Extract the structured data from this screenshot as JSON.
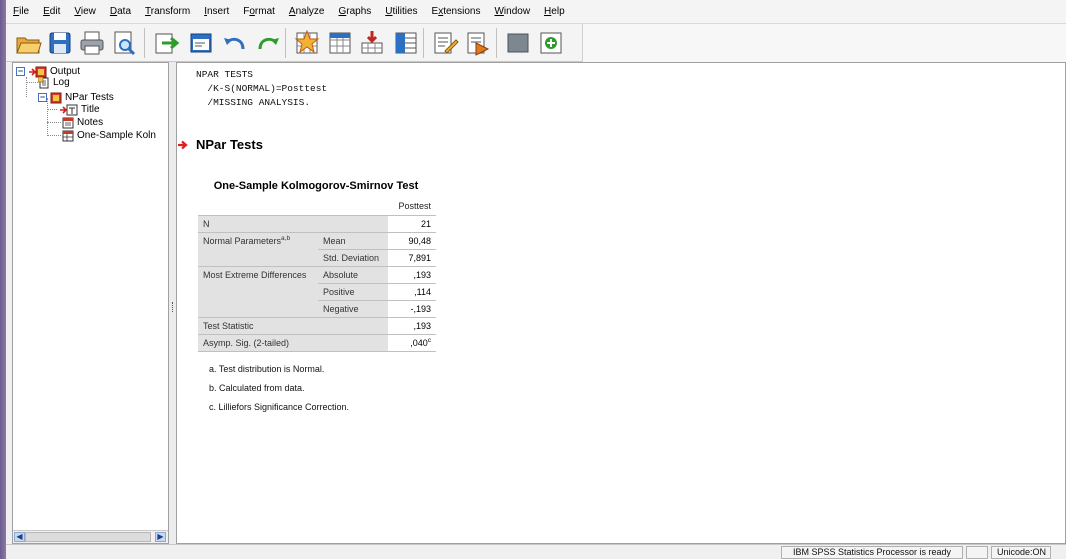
{
  "menu": [
    "File",
    "Edit",
    "View",
    "Data",
    "Transform",
    "Insert",
    "Format",
    "Analyze",
    "Graphs",
    "Utilities",
    "Extensions",
    "Window",
    "Help"
  ],
  "menu_underline": [
    "F",
    "E",
    "V",
    "D",
    "T",
    "I",
    "o",
    "A",
    "G",
    "U",
    "x",
    "W",
    "H"
  ],
  "toolbar_icons": [
    "open-icon",
    "save-icon",
    "print-icon",
    "print-preview-icon",
    "export-icon",
    "recall-dialog-icon",
    "undo-icon",
    "redo-icon",
    "goto-data-icon",
    "goto-case-icon",
    "variables-icon",
    "split-file-icon",
    "insert-output-icon",
    "insert-syntax-icon",
    "designate-window-icon",
    "add-icon"
  ],
  "outline": {
    "root": "Output",
    "log": "Log",
    "group": "NPar Tests",
    "title": "Title",
    "notes": "Notes",
    "test": "One-Sample Koln"
  },
  "syntax": [
    "NPAR TESTS",
    "  /K-S(NORMAL)=Posttest",
    "  /MISSING ANALYSIS."
  ],
  "heading": "NPar Tests",
  "table": {
    "title": "One-Sample Kolmogorov-Smirnov Test",
    "column": "Posttest",
    "n_label": "N",
    "n_value": "21",
    "normal_label": "Normal Parameters",
    "normal_sup": "a,b",
    "mean_label": "Mean",
    "mean_value": "90,48",
    "sd_label": "Std. Deviation",
    "sd_value": "7,891",
    "extreme_label": "Most Extreme Differences",
    "abs_label": "Absolute",
    "abs_value": ",193",
    "pos_label": "Positive",
    "pos_value": ",114",
    "neg_label": "Negative",
    "neg_value": "-,193",
    "stat_label": "Test Statistic",
    "stat_value": ",193",
    "sig_label": "Asymp. Sig. (2-tailed)",
    "sig_value": ",040",
    "sig_sup": "c"
  },
  "footnotes": [
    "a. Test distribution is Normal.",
    "b. Calculated from data.",
    "c. Lilliefors Significance Correction."
  ],
  "status": {
    "processor": "IBM SPSS Statistics Processor is ready",
    "unicode": "Unicode:ON"
  }
}
